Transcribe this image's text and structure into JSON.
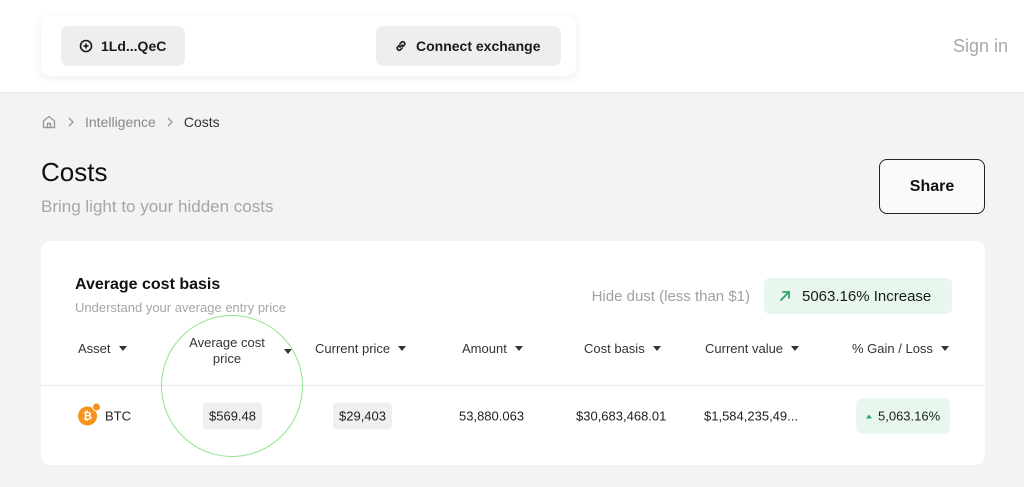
{
  "topbar": {
    "wallet_label": "1Ld...QeC",
    "exchange_label": "Connect exchange",
    "signin_label": "Sign in"
  },
  "breadcrumb": {
    "items": [
      "Intelligence",
      "Costs"
    ]
  },
  "page": {
    "title": "Costs",
    "subtitle": "Bring light to your hidden costs",
    "share_label": "Share"
  },
  "card": {
    "title": "Average cost basis",
    "subtitle": "Understand your average entry price",
    "hide_dust_label": "Hide dust (less than $1)",
    "increase_label": "5063.16% Increase",
    "columns": {
      "asset": "Asset",
      "avg_cost_line1": "Average cost",
      "avg_cost_line2": "price",
      "current_price": "Current price",
      "amount": "Amount",
      "cost_basis": "Cost basis",
      "current_value": "Current value",
      "gain_loss": "% Gain / Loss"
    },
    "rows": [
      {
        "asset": "BTC",
        "avg_cost": "$569.48",
        "current_price": "$29,403",
        "amount": "53,880.063",
        "cost_basis": "$30,683,468.01",
        "current_value": "$1,584,235,49...",
        "gain_loss": "5,063.16%"
      }
    ]
  },
  "colors": {
    "accent_green": "#2fa36a",
    "badge_bg": "#e7f7ee",
    "btc_orange": "#f7931a",
    "highlight_circle": "#8fe38b"
  },
  "icons": {
    "wallet": "plus-circle-icon",
    "exchange": "link-icon",
    "home": "home-icon",
    "increase": "arrow-up-right-icon",
    "asset": "bitcoin-icon"
  }
}
